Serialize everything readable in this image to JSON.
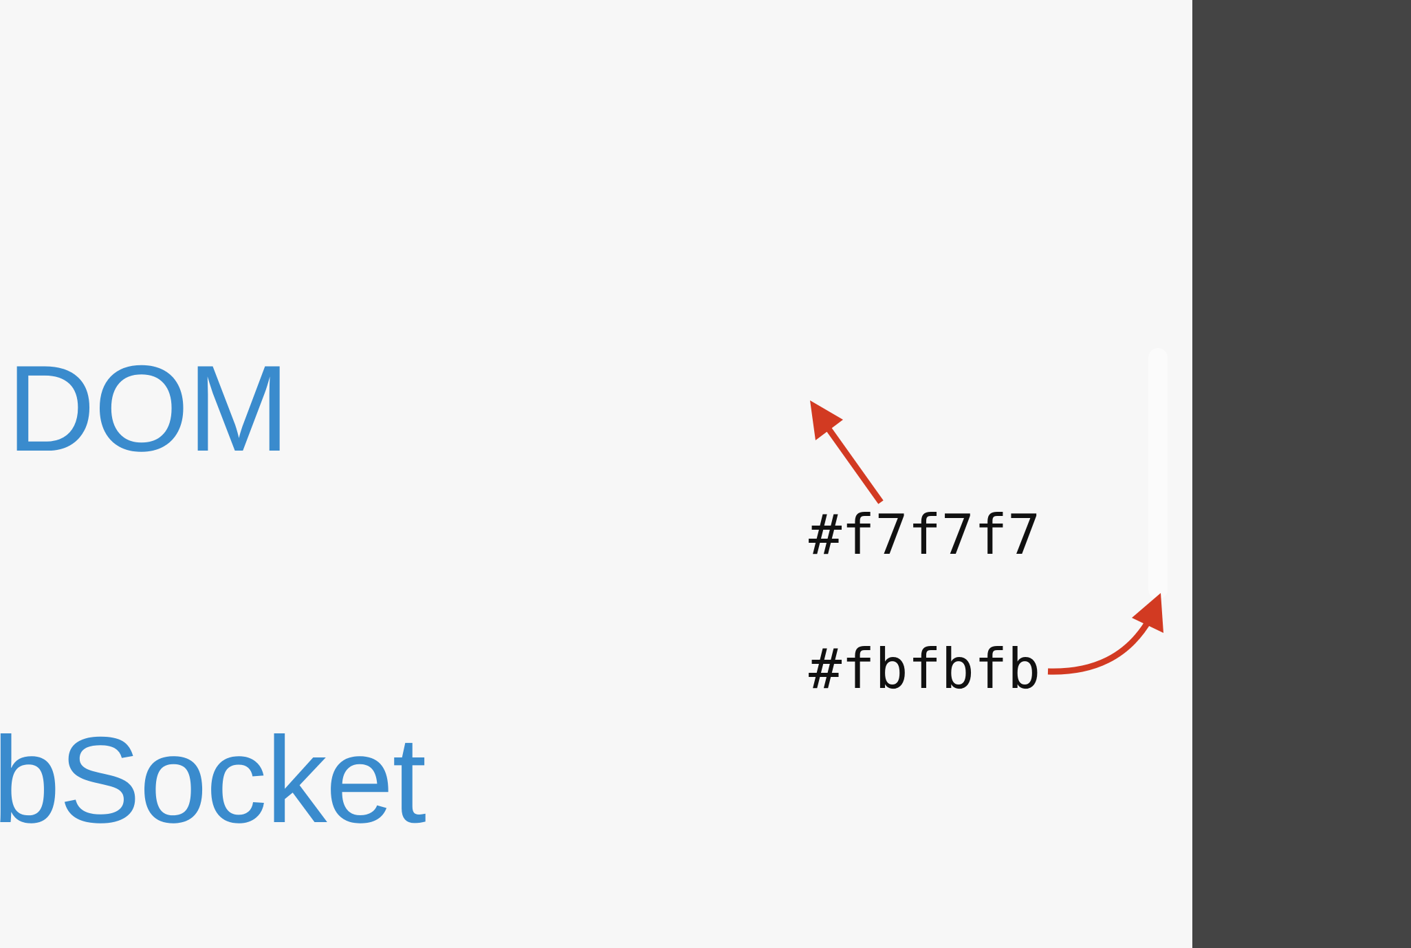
{
  "sidebar": {
    "links": [
      {
        "label": "DOM"
      },
      {
        "label": "bSocket"
      }
    ],
    "background_color": "#f7f7f7",
    "link_color": "#3a8bcd"
  },
  "scrollbar": {
    "track_color": "#fbfbfb"
  },
  "dark_panel": {
    "color": "#444444"
  },
  "annotations": {
    "background_hex": "#f7f7f7",
    "track_hex": "#fbfbfb",
    "arrow_color": "#d23a22"
  }
}
